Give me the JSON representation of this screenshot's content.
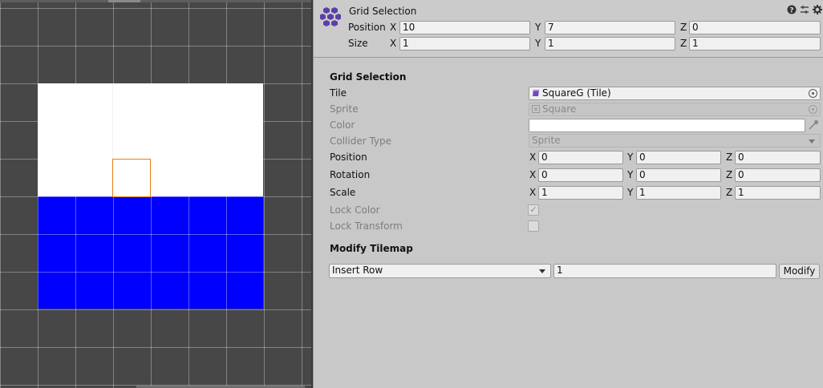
{
  "scene": {
    "grid": true
  },
  "header": {
    "title": "Grid Selection",
    "position": {
      "label": "Position",
      "x": "10",
      "y": "7",
      "z": "0"
    },
    "size": {
      "label": "Size",
      "x": "1",
      "y": "1",
      "z": "1"
    },
    "axis": {
      "x": "X",
      "y": "Y",
      "z": "Z"
    }
  },
  "section_grid": {
    "title": "Grid Selection",
    "tile": {
      "label": "Tile",
      "value": "SquareG (Tile)"
    },
    "sprite": {
      "label": "Sprite",
      "value": "Square"
    },
    "color": {
      "label": "Color",
      "value": "#ffffff"
    },
    "collider_type": {
      "label": "Collider Type",
      "value": "Sprite"
    },
    "position": {
      "label": "Position",
      "x": "0",
      "y": "0",
      "z": "0"
    },
    "rotation": {
      "label": "Rotation",
      "x": "0",
      "y": "0",
      "z": "0"
    },
    "scale": {
      "label": "Scale",
      "x": "1",
      "y": "1",
      "z": "1"
    },
    "lock_color": {
      "label": "Lock Color",
      "checked": true,
      "check_glyph": "✓"
    },
    "lock_transform": {
      "label": "Lock Transform",
      "checked": false
    }
  },
  "section_modify": {
    "title": "Modify Tilemap",
    "operation": "Insert Row",
    "count": "1",
    "button_label": "Modify"
  },
  "icons": {
    "component": "tilemap-hex-icon",
    "help": "help-icon",
    "presets": "presets-icon",
    "settings": "gear-icon"
  },
  "colors": {
    "scene_bg": "#474747",
    "tile_white": "#ffffff",
    "tile_blue": "#0000ff",
    "selection": "#e87d0d",
    "inspector_bg": "#c8c8c8",
    "icon_purple": "#5b3fa8"
  }
}
